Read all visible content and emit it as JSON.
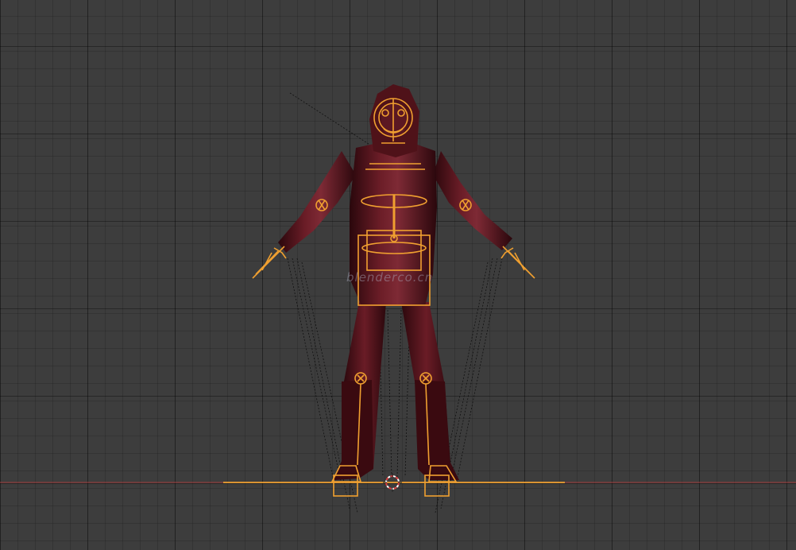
{
  "viewport": {
    "background_color": "#3d3d3d",
    "grid_color": "#2f2f2f",
    "x_axis_color": "#b23a3a"
  },
  "watermark": {
    "text": "blenderco.cn"
  },
  "character": {
    "body_color": "#4a1018",
    "highlight_color": "#8a3440"
  },
  "armature": {
    "color": "#f0a030",
    "selected_color": "#ffb840"
  },
  "icons": {
    "cursor": "3d-cursor-icon"
  }
}
